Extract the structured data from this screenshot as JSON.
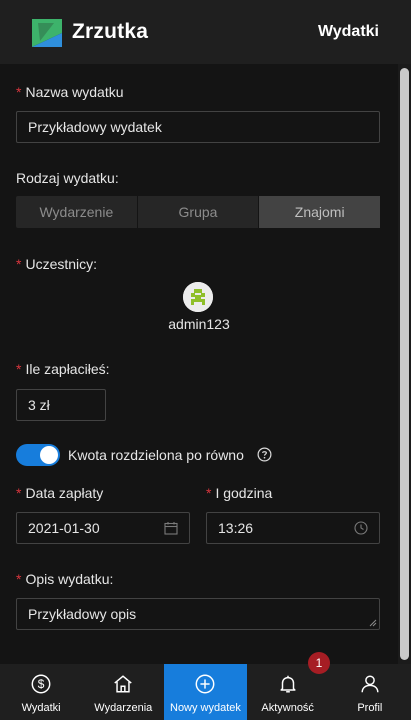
{
  "header": {
    "brand": "Zrzutka",
    "title": "Wydatki"
  },
  "form": {
    "name_label": "Nazwa wydatku",
    "name_value": "Przykładowy wydatek",
    "type_label": "Rodzaj wydatku:",
    "type_options": [
      "Wydarzenie",
      "Grupa",
      "Znajomi"
    ],
    "type_selected": "Znajomi",
    "participants_label": "Uczestnicy:",
    "participants": [
      {
        "name": "admin123"
      }
    ],
    "paid_label": "Ile zapłaciłeś:",
    "paid_value": "3 zł",
    "split_toggle_label": "Kwota rozdzielona po równo",
    "split_toggle_on": true,
    "date_label": "Data zapłaty",
    "date_value": "2021-01-30",
    "time_label": "I godzina",
    "time_value": "13:26",
    "desc_label": "Opis wydatku:",
    "desc_value": "Przykładowy opis",
    "required_mark": "*"
  },
  "nav": {
    "items": [
      {
        "label": "Wydatki",
        "icon": "dollar-circle-icon"
      },
      {
        "label": "Wydarzenia",
        "icon": "home-icon"
      },
      {
        "label": "Nowy wydatek",
        "icon": "plus-circle-icon"
      },
      {
        "label": "Aktywność",
        "icon": "bell-icon"
      },
      {
        "label": "Profil",
        "icon": "user-icon"
      }
    ],
    "active": "Nowy wydatek",
    "activity_badge": "1"
  },
  "colors": {
    "accent": "#177ddc",
    "required": "#d9363e",
    "badge": "#a61d24",
    "logo_green": "#3db36b",
    "logo_blue": "#2f8fdc"
  }
}
